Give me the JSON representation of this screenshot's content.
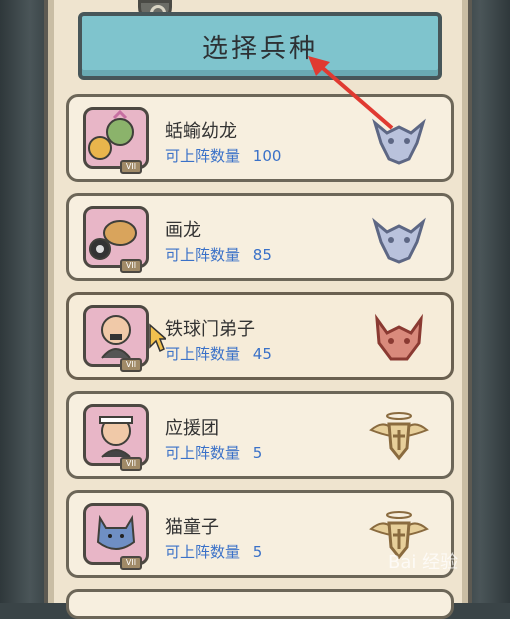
{
  "title": "选择兵种",
  "units": [
    {
      "name": "蛞蝓幼龙",
      "count_label": "可上阵数量",
      "count": "100",
      "rank": "VII",
      "emblem": "dragon-head-icon",
      "emblem_color": "#5d6784",
      "avatar_color": "#e8b6c7"
    },
    {
      "name": "画龙",
      "count_label": "可上阵数量",
      "count": "85",
      "rank": "VII",
      "emblem": "dragon-head-icon",
      "emblem_color": "#5d6784",
      "avatar_color": "#e8b6c7"
    },
    {
      "name": "铁球门弟子",
      "count_label": "可上阵数量",
      "count": "45",
      "rank": "VII",
      "emblem": "demon-head-icon",
      "emblem_color": "#8a3a32",
      "avatar_color": "#e8b6c7"
    },
    {
      "name": "应援团",
      "count_label": "可上阵数量",
      "count": "5",
      "rank": "VII",
      "emblem": "winged-shield-icon",
      "emblem_color": "#8a6b3f",
      "avatar_color": "#e8b6c7"
    },
    {
      "name": "猫童子",
      "count_label": "可上阵数量",
      "count": "5",
      "rank": "VII",
      "emblem": "winged-shield-icon",
      "emblem_color": "#8a6b3f",
      "avatar_color": "#e8b6c7"
    }
  ],
  "watermark": "Bai 经验"
}
